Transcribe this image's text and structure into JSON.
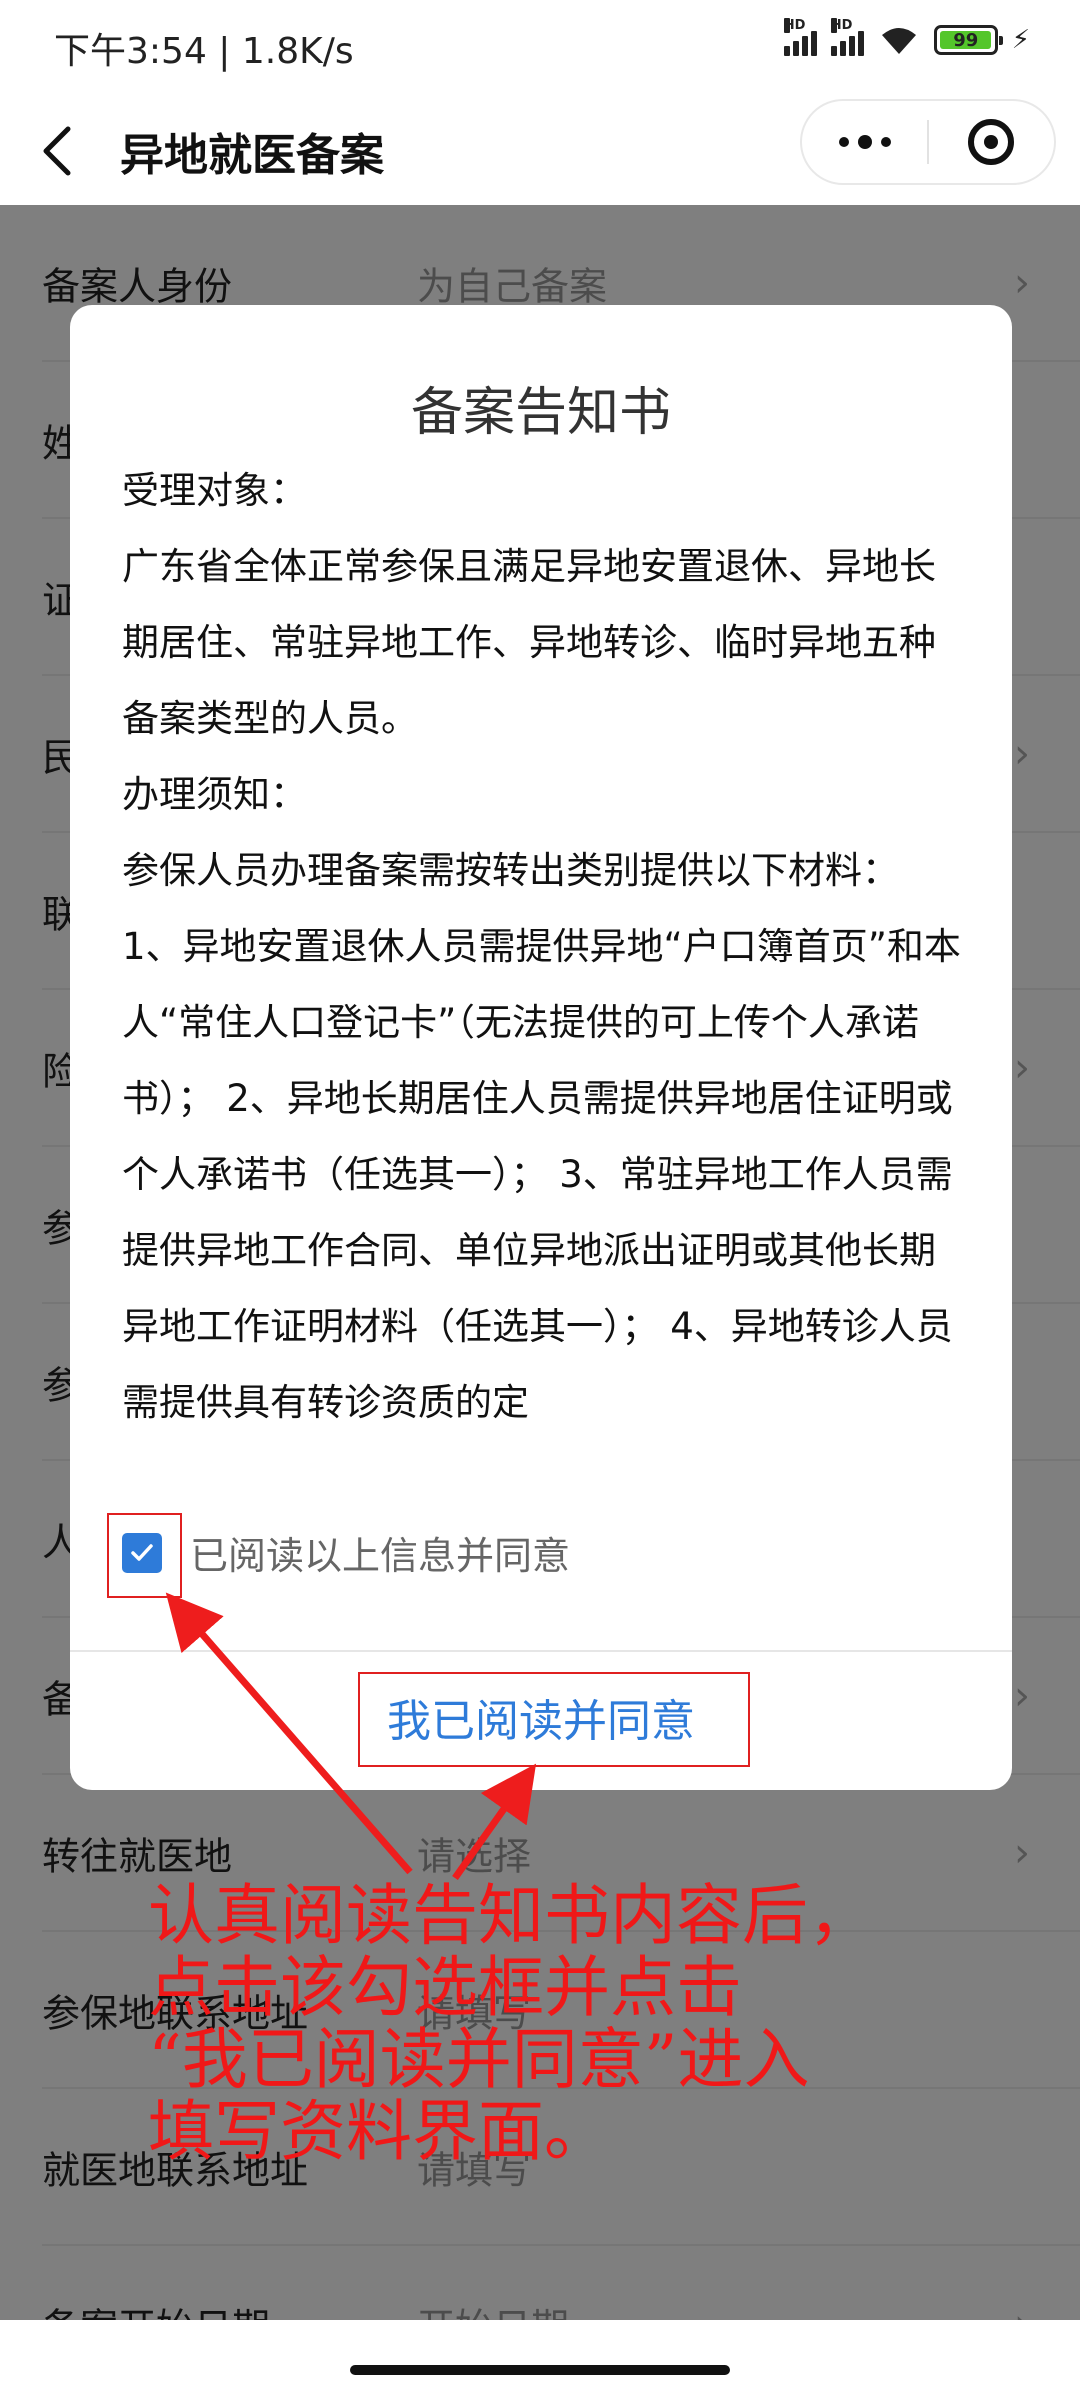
{
  "status_bar": {
    "time": "下午3:54 | 1.8K/s",
    "signal_label": "HD",
    "battery": "99",
    "battery_level": 0.99
  },
  "nav": {
    "title": "异地就医备案"
  },
  "form": {
    "rows": [
      {
        "label": "备案人身份",
        "value": "为自己备案",
        "arrow": true
      },
      {
        "label": "姓名",
        "value": "",
        "arrow": false
      },
      {
        "label": "证件号码",
        "value": "",
        "arrow": false
      },
      {
        "label": "民族",
        "value": "",
        "arrow": true
      },
      {
        "label": "联系电话",
        "value": "",
        "arrow": false
      },
      {
        "label": "险种类型",
        "value": "",
        "arrow": true
      },
      {
        "label": "参保地",
        "value": "",
        "arrow": false
      },
      {
        "label": "参保人员类别",
        "value": "",
        "arrow": false
      },
      {
        "label": "人员",
        "value": "",
        "arrow": false
      },
      {
        "label": "备案类型",
        "value": "",
        "arrow": true
      },
      {
        "label": "转往就医地",
        "value": "请选择",
        "arrow": true
      },
      {
        "label": "参保地联系地址",
        "value": "请填写",
        "arrow": false
      },
      {
        "label": "就医地联系地址",
        "value": "请填写",
        "arrow": false
      },
      {
        "label": "备案开始日期",
        "value": "开始日期",
        "arrow": true
      }
    ]
  },
  "modal": {
    "title": "备案告知书",
    "body": [
      "受理对象：",
      "广东省全体正常参保且满足异地安置退休、异地长期居住、常驻异地工作、异地转诊、临时异地五种备案类型的人员。",
      "办理须知：",
      "参保人员办理备案需按转出类别提供以下材料：",
      "1、异地安置退休人员需提供异地“户口簿首页”和本人“常住人口登记卡”（无法提供的可上传个人承诺书）； 2、异地长期居住人员需提供异地居住证明或个人承诺书（任选其一）； 3、常驻异地工作人员需提供异地工作合同、单位异地派出证明或其他长期异地工作证明材料（任选其一）； 4、异地转诊人员需提供具有转诊资质的定"
    ],
    "checkbox_label": "已阅读以上信息并同意",
    "checkbox_checked": true,
    "confirm_button": "我已阅读并同意"
  },
  "annotation": {
    "text": "认真阅读告知书内容后，\n点击该勾选框并点击\n“我已阅读并同意”进入\n填写资料界面。",
    "color": "#f01818"
  },
  "colors": {
    "accent": "#2e7bd9",
    "annotation": "#f01818"
  }
}
